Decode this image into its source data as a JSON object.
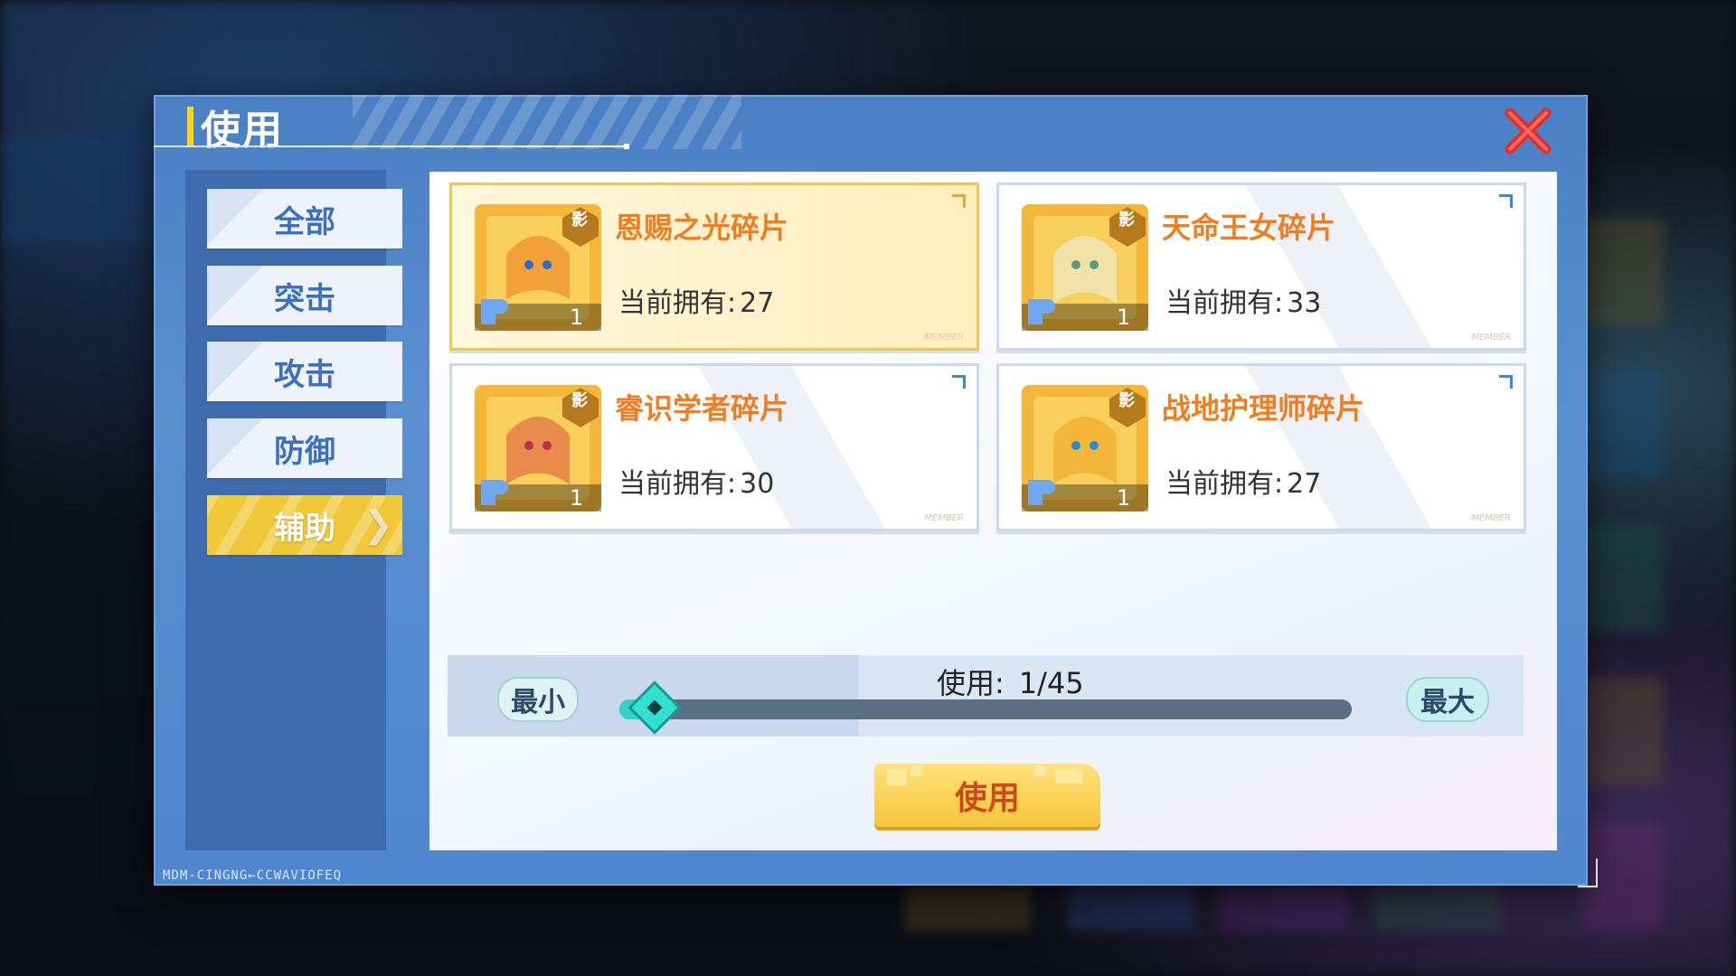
{
  "dialog": {
    "title": "使用",
    "footer_code": "MDM-CINGNG←CCWAVIOFEQ"
  },
  "tabs": [
    {
      "label": "全部",
      "active": false
    },
    {
      "label": "突击",
      "active": false
    },
    {
      "label": "攻击",
      "active": false
    },
    {
      "label": "防御",
      "active": false
    },
    {
      "label": "辅助",
      "active": true
    }
  ],
  "items": [
    {
      "name": "恩赐之光碎片",
      "owned_label": "当前拥有:",
      "owned": "27",
      "badge": "影",
      "count": "1",
      "member": "MEMBER",
      "selected": true
    },
    {
      "name": "天命王女碎片",
      "owned_label": "当前拥有:",
      "owned": "33",
      "badge": "影",
      "count": "1",
      "member": "MEMBER",
      "selected": false
    },
    {
      "name": "睿识学者碎片",
      "owned_label": "当前拥有:",
      "owned": "30",
      "badge": "影",
      "count": "1",
      "member": "MEMBER",
      "selected": false
    },
    {
      "name": "战地护理师碎片",
      "owned_label": "当前拥有:",
      "owned": "27",
      "badge": "影",
      "count": "1",
      "member": "MEMBER",
      "selected": false
    }
  ],
  "usage": {
    "label": "使用:",
    "value": "1/45",
    "current": 1,
    "max": 45,
    "min_label": "最小",
    "max_label": "最大"
  },
  "use_button": "使用",
  "icons": {
    "close": "close-x-icon",
    "puzzle": "puzzle-piece-icon"
  },
  "colors": {
    "accent": "#f0c93a",
    "item_name": "#f07d1f",
    "close": "#e02d2d",
    "slider": "#33e0cf"
  }
}
